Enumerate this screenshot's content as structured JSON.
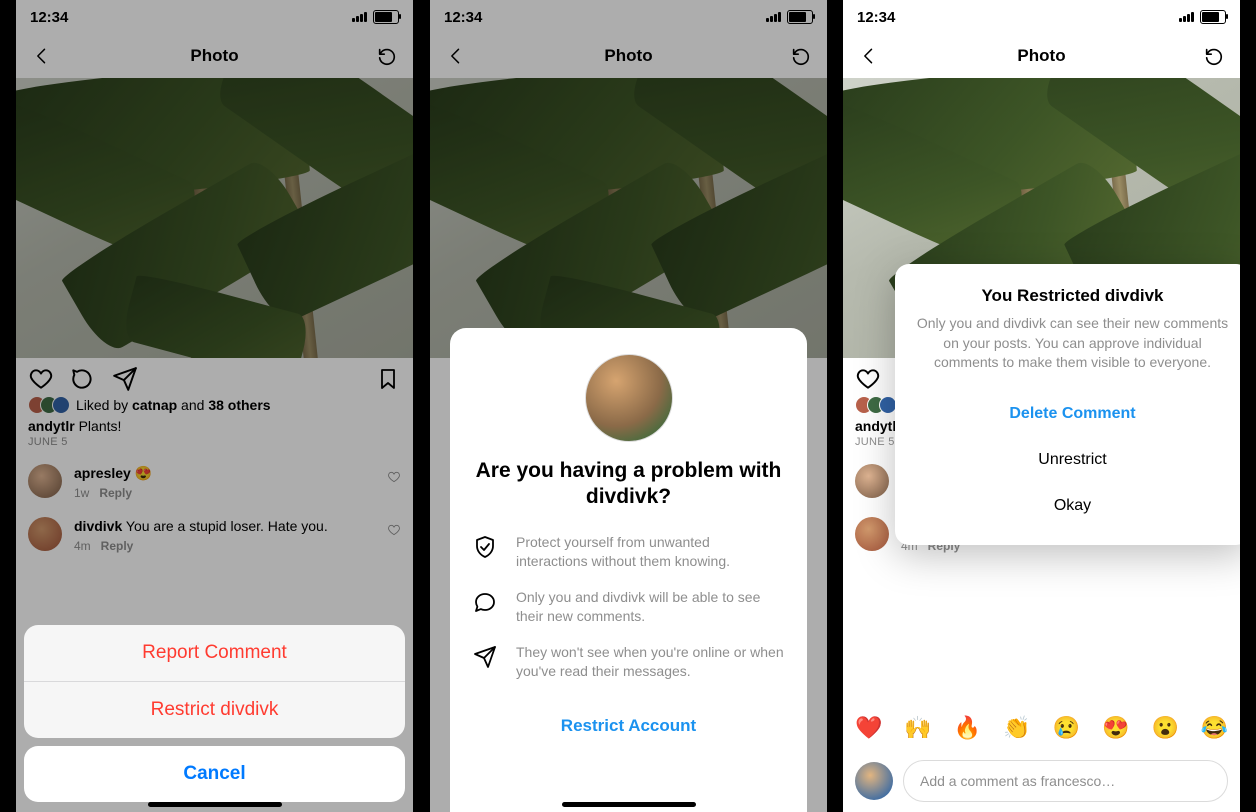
{
  "statusbar": {
    "time": "12:34"
  },
  "nav": {
    "title": "Photo"
  },
  "post": {
    "liked_prefix": "Liked by ",
    "liked_user": "catnap",
    "liked_mid": " and ",
    "liked_count": "38 others",
    "author": "andytlr",
    "caption": "Plants!",
    "date": "JUNE 5"
  },
  "comments": [
    {
      "user": "apresley",
      "text": "😍",
      "age": "1w",
      "reply": "Reply"
    },
    {
      "user": "divdivk",
      "text": "You are a stupid loser. Hate you.",
      "age": "4m",
      "reply": "Reply"
    }
  ],
  "sheet": {
    "report": "Report Comment",
    "restrict": "Restrict divdivk",
    "cancel": "Cancel"
  },
  "problem_modal": {
    "title": "Are you having a problem with divdivk?",
    "b1": "Protect yourself from unwanted interactions without them knowing.",
    "b2": "Only you and divdivk will be able to see their new comments.",
    "b3": "They won't see when you're online or when you've read their messages.",
    "action": "Restrict Account"
  },
  "confirm_modal": {
    "title": "You Restricted divdivk",
    "body": "Only you and divdivk can see their new comments on your posts. You can approve individual comments to make them visible to everyone.",
    "delete": "Delete Comment",
    "unrestrict": "Unrestrict",
    "okay": "Okay"
  },
  "composer": {
    "placeholder": "Add a comment as francesco…",
    "emoji": [
      "❤️",
      "🙌",
      "🔥",
      "👏",
      "😢",
      "😍",
      "😮",
      "😂"
    ]
  }
}
